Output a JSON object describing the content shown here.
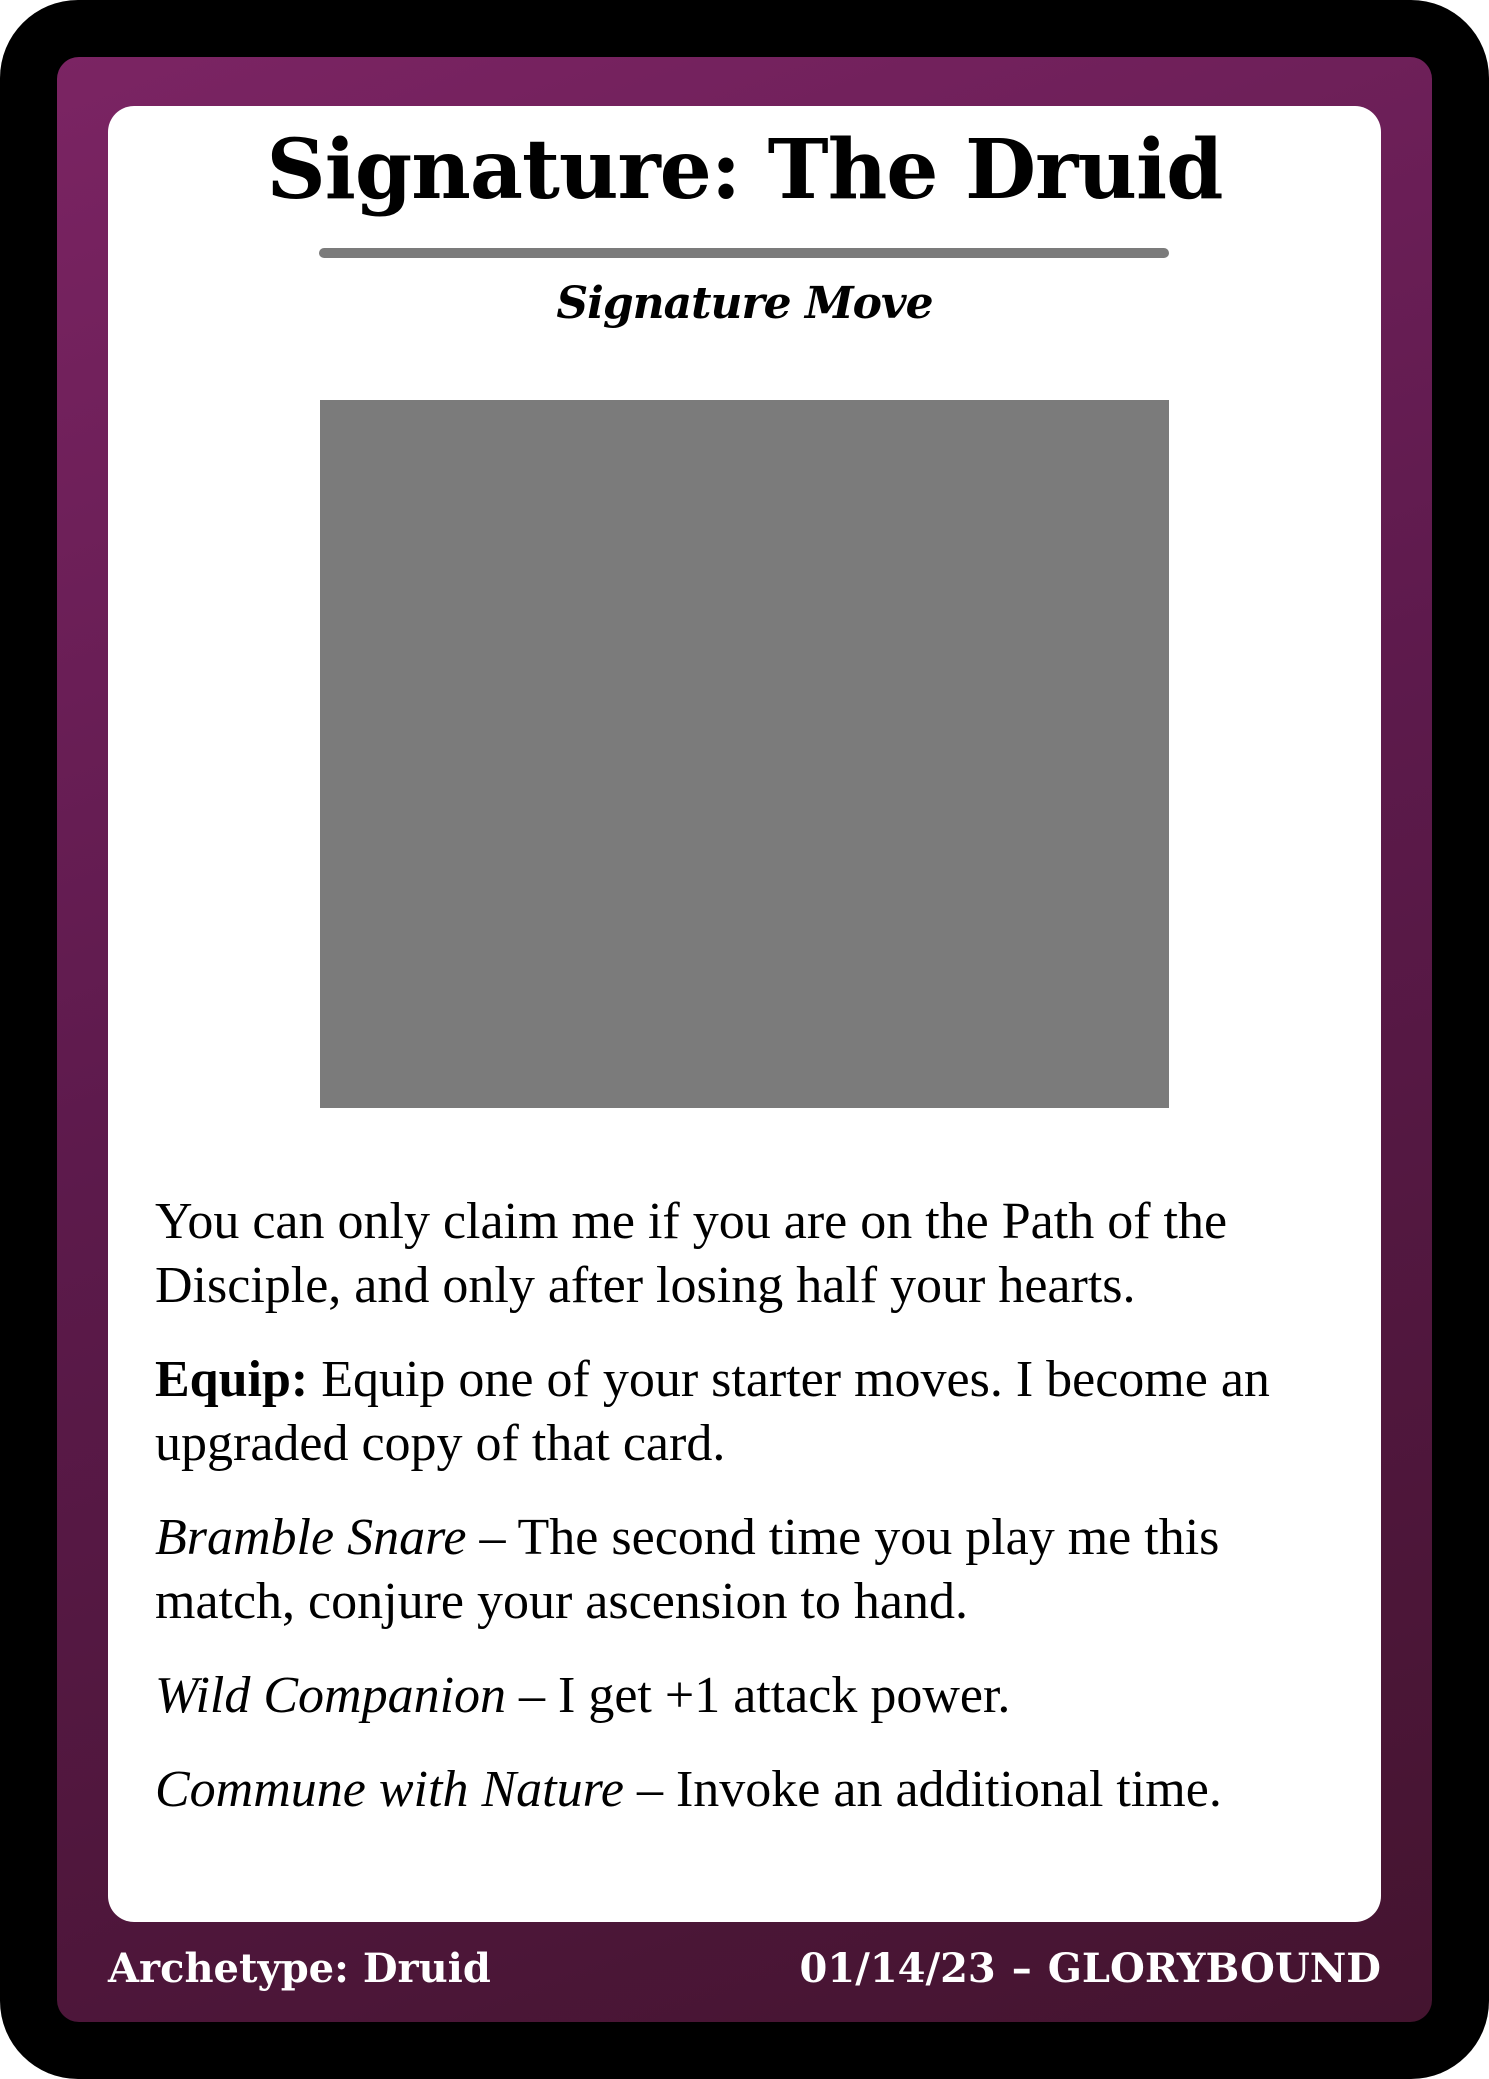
{
  "card": {
    "title": "Signature: The Druid",
    "subtitle": "Signature Move",
    "text": {
      "intro": "You can only claim me if you are on the Path of the Disciple, and only after losing half your hearts.",
      "equip_keyword": "Equip:",
      "equip_text": " Equip one of your starter moves. I become an upgraded copy of that card.",
      "abilities": [
        {
          "name": "Bramble Snare",
          "text": " – The second time you play me this match, conjure your ascension to hand."
        },
        {
          "name": "Wild Companion",
          "text": " – I get +1 attack power."
        },
        {
          "name": "Commune with Nature",
          "text": " – Invoke an additional time."
        }
      ]
    },
    "footer": {
      "archetype": "Archetype: Druid",
      "date": "01/14/23",
      "separator": "–",
      "brand": "GLORYBOUND"
    }
  },
  "colors": {
    "outer_border": "#000000",
    "frame_top": "#7b2463",
    "frame_bottom": "#44142f",
    "placeholder_art": "#7b7b7b",
    "rule": "#7b7b7b"
  }
}
